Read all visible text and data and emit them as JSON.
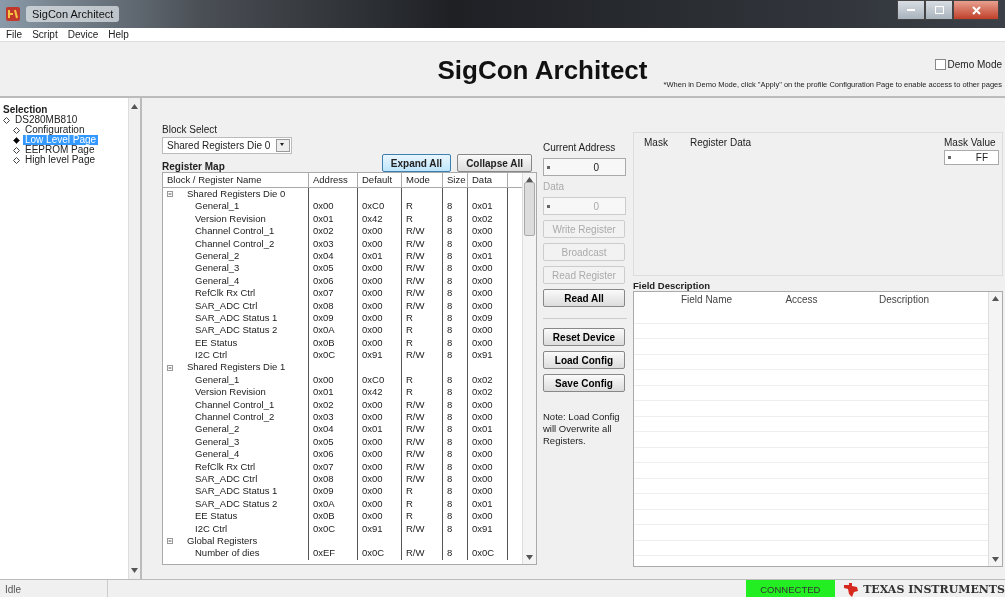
{
  "window": {
    "title": "SigCon Architect"
  },
  "menu": [
    "File",
    "Script",
    "Device",
    "Help"
  ],
  "header": {
    "title": "SigCon Architect",
    "demo_mode": {
      "label": "Demo Mode",
      "checked": false
    },
    "note": "*When in Demo Mode, click \"Apply\" on the profile Configuration Page to enable access to other pages"
  },
  "sidebar": {
    "title": "Selection",
    "tree": [
      {
        "label": "DS280MB810",
        "selected": false,
        "children": [
          {
            "label": "Configuration",
            "selected": false
          },
          {
            "label": "Low Level Page",
            "selected": true
          },
          {
            "label": "EEPROM Page",
            "selected": false
          },
          {
            "label": "High level Page",
            "selected": false
          }
        ]
      }
    ]
  },
  "block_select": {
    "label": "Block Select",
    "value": "Shared Registers Die 0"
  },
  "register_map": {
    "title": "Register Map",
    "buttons": [
      "Expand All",
      "Collapse All"
    ],
    "columns": [
      "Block / Register Name",
      "Address",
      "Default",
      "Mode",
      "Size",
      "Data"
    ],
    "groups": [
      {
        "name": "Shared Registers Die 0",
        "expanded": true,
        "children": [
          {
            "name": "General_1",
            "address": "0x00",
            "default": "0xC0",
            "mode": "R",
            "size": "8",
            "data": "0x01"
          },
          {
            "name": "Version Revision",
            "address": "0x01",
            "default": "0x42",
            "mode": "R",
            "size": "8",
            "data": "0x02"
          },
          {
            "name": "Channel Control_1",
            "address": "0x02",
            "default": "0x00",
            "mode": "R/W",
            "size": "8",
            "data": "0x00"
          },
          {
            "name": "Channel Control_2",
            "address": "0x03",
            "default": "0x00",
            "mode": "R/W",
            "size": "8",
            "data": "0x00"
          },
          {
            "name": "General_2",
            "address": "0x04",
            "default": "0x01",
            "mode": "R/W",
            "size": "8",
            "data": "0x01"
          },
          {
            "name": "General_3",
            "address": "0x05",
            "default": "0x00",
            "mode": "R/W",
            "size": "8",
            "data": "0x00"
          },
          {
            "name": "General_4",
            "address": "0x06",
            "default": "0x00",
            "mode": "R/W",
            "size": "8",
            "data": "0x00"
          },
          {
            "name": "RefClk Rx Ctrl",
            "address": "0x07",
            "default": "0x00",
            "mode": "R/W",
            "size": "8",
            "data": "0x00"
          },
          {
            "name": "SAR_ADC Ctrl",
            "address": "0x08",
            "default": "0x00",
            "mode": "R/W",
            "size": "8",
            "data": "0x00"
          },
          {
            "name": "SAR_ADC Status 1",
            "address": "0x09",
            "default": "0x00",
            "mode": "R",
            "size": "8",
            "data": "0x09"
          },
          {
            "name": "SAR_ADC Status 2",
            "address": "0x0A",
            "default": "0x00",
            "mode": "R",
            "size": "8",
            "data": "0x00"
          },
          {
            "name": "EE Status",
            "address": "0x0B",
            "default": "0x00",
            "mode": "R",
            "size": "8",
            "data": "0x00"
          },
          {
            "name": "I2C Ctrl",
            "address": "0x0C",
            "default": "0x91",
            "mode": "R/W",
            "size": "8",
            "data": "0x91"
          }
        ]
      },
      {
        "name": "Shared Registers Die 1",
        "expanded": true,
        "children": [
          {
            "name": "General_1",
            "address": "0x00",
            "default": "0xC0",
            "mode": "R",
            "size": "8",
            "data": "0x02"
          },
          {
            "name": "Version Revision",
            "address": "0x01",
            "default": "0x42",
            "mode": "R",
            "size": "8",
            "data": "0x02"
          },
          {
            "name": "Channel Control_1",
            "address": "0x02",
            "default": "0x00",
            "mode": "R/W",
            "size": "8",
            "data": "0x00"
          },
          {
            "name": "Channel Control_2",
            "address": "0x03",
            "default": "0x00",
            "mode": "R/W",
            "size": "8",
            "data": "0x00"
          },
          {
            "name": "General_2",
            "address": "0x04",
            "default": "0x01",
            "mode": "R/W",
            "size": "8",
            "data": "0x01"
          },
          {
            "name": "General_3",
            "address": "0x05",
            "default": "0x00",
            "mode": "R/W",
            "size": "8",
            "data": "0x00"
          },
          {
            "name": "General_4",
            "address": "0x06",
            "default": "0x00",
            "mode": "R/W",
            "size": "8",
            "data": "0x00"
          },
          {
            "name": "RefClk Rx Ctrl",
            "address": "0x07",
            "default": "0x00",
            "mode": "R/W",
            "size": "8",
            "data": "0x00"
          },
          {
            "name": "SAR_ADC Ctrl",
            "address": "0x08",
            "default": "0x00",
            "mode": "R/W",
            "size": "8",
            "data": "0x00"
          },
          {
            "name": "SAR_ADC Status 1",
            "address": "0x09",
            "default": "0x00",
            "mode": "R",
            "size": "8",
            "data": "0x00"
          },
          {
            "name": "SAR_ADC Status 2",
            "address": "0x0A",
            "default": "0x00",
            "mode": "R",
            "size": "8",
            "data": "0x01"
          },
          {
            "name": "EE Status",
            "address": "0x0B",
            "default": "0x00",
            "mode": "R",
            "size": "8",
            "data": "0x00"
          },
          {
            "name": "I2C Ctrl",
            "address": "0x0C",
            "default": "0x91",
            "mode": "R/W",
            "size": "8",
            "data": "0x91"
          }
        ]
      },
      {
        "name": "Global Registers",
        "expanded": true,
        "children": [
          {
            "name": "Number of dies",
            "address": "0xEF",
            "default": "0x0C",
            "mode": "R/W",
            "size": "8",
            "data": "0x0C"
          }
        ]
      }
    ]
  },
  "controls": {
    "current_address": {
      "label": "Current Address",
      "value": "0",
      "disabled": false
    },
    "data": {
      "label": "Data",
      "value": "0",
      "disabled": true
    },
    "buttons": [
      {
        "label": "Write Register",
        "disabled": true
      },
      {
        "label": "Broadcast",
        "disabled": true
      },
      {
        "label": "Read Register",
        "disabled": true
      },
      {
        "label": "Read All",
        "disabled": false
      }
    ],
    "device_buttons": [
      {
        "label": "Reset Device",
        "disabled": false
      },
      {
        "label": "Load Config",
        "disabled": false
      },
      {
        "label": "Save Config",
        "disabled": false
      }
    ],
    "note": "Note: Load Config will Overwrite all Registers."
  },
  "mask_panel": {
    "columns": [
      "Mask",
      "Register Data"
    ],
    "mask_value": {
      "label": "Mask Value",
      "value": "FF"
    }
  },
  "field_description": {
    "title": "Field Description",
    "columns": [
      "Field Name",
      "Access",
      "Description"
    ]
  },
  "status_bar": {
    "status": "Idle",
    "connection": "CONNECTED",
    "brand": "TEXAS INSTRUMENTS"
  }
}
